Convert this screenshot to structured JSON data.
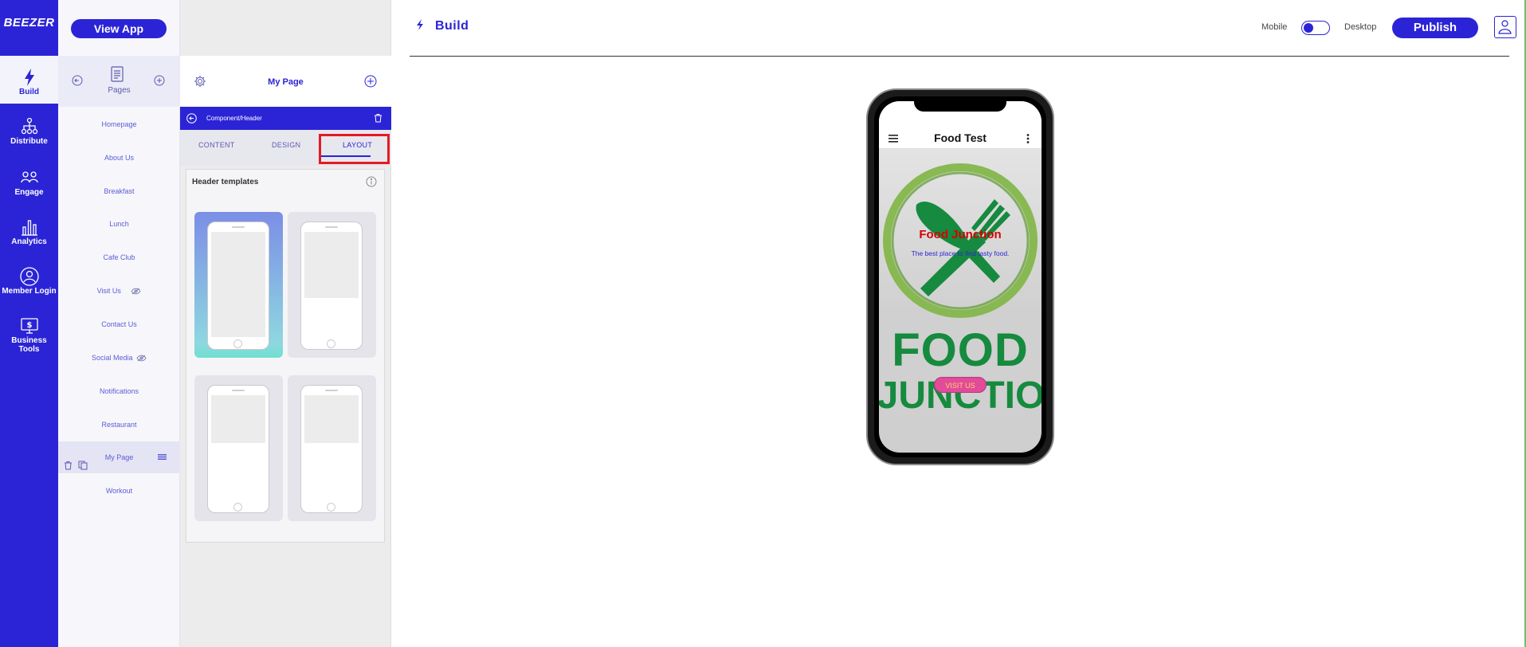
{
  "rail": {
    "logo": "BEEZER",
    "items": [
      {
        "label": "Build",
        "icon": "bolt-icon"
      },
      {
        "label": "Distribute",
        "icon": "hierarchy-icon"
      },
      {
        "label": "Engage",
        "icon": "people-icon"
      },
      {
        "label": "Analytics",
        "icon": "bar-chart-icon"
      },
      {
        "label": "Member Login",
        "icon": "user-circle-icon"
      },
      {
        "label": "Business Tools",
        "icon": "monitor-dollar-icon"
      }
    ]
  },
  "pages": {
    "view_app": "View App",
    "header_label": "Pages",
    "items": [
      "Homepage",
      "About Us",
      "Breakfast",
      "Lunch",
      "Cafe Club",
      "Visit Us",
      "Contact Us",
      "Social Media",
      "Notifications",
      "Restaurant",
      "My Page",
      "Workout"
    ],
    "selected": "My Page"
  },
  "panel": {
    "title": "My Page",
    "component_path": "Component/Header",
    "tabs": [
      "CONTENT",
      "DESIGN",
      "LAYOUT"
    ],
    "active_tab": "LAYOUT",
    "templates_title": "Header templates"
  },
  "main": {
    "title": "Build",
    "mode_mobile": "Mobile",
    "mode_desktop": "Desktop",
    "publish": "Publish"
  },
  "preview": {
    "app_title": "Food Test",
    "hero_name": "Food Junction",
    "hero_tagline": "The best place to find tasty food.",
    "big_text_1": "FOOD",
    "big_text_2": "JUNCTIO",
    "visit_button": "VISIT US"
  },
  "colors": {
    "brand": "#2b24d6",
    "highlight": "#e31b23",
    "food_green": "#168a3e",
    "hero_red": "#d60000",
    "visit_pink": "#e24a9a"
  }
}
